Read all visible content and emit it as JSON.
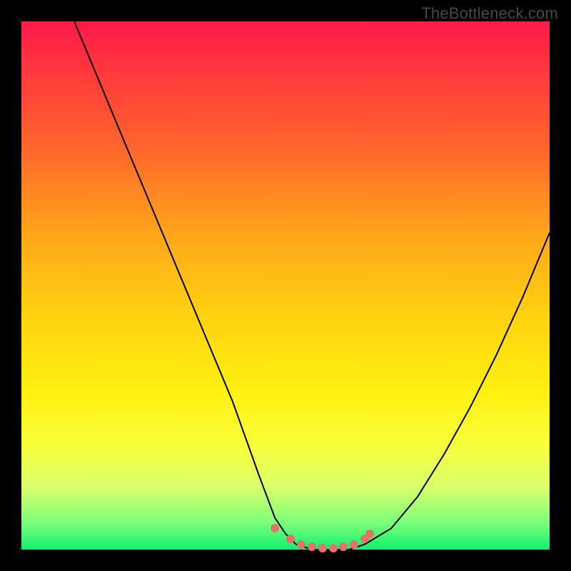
{
  "watermark": "TheBottleneck.com",
  "chart_data": {
    "type": "line",
    "title": "",
    "xlabel": "",
    "ylabel": "",
    "xlim": [
      0,
      100
    ],
    "ylim": [
      0,
      100
    ],
    "series": [
      {
        "name": "curve",
        "x": [
          10,
          15,
          20,
          25,
          30,
          35,
          40,
          45,
          48,
          50,
          52,
          55,
          58,
          60,
          62,
          65,
          70,
          75,
          80,
          85,
          90,
          95,
          100
        ],
        "y": [
          100,
          88,
          76,
          64,
          52,
          40,
          28,
          14,
          6,
          3,
          1,
          0,
          0,
          0,
          0,
          1,
          4,
          10,
          18,
          27,
          37,
          48,
          60
        ]
      }
    ],
    "markers": {
      "name": "bottom-dots",
      "x": [
        48,
        51,
        53,
        55,
        57,
        59,
        61,
        63,
        65,
        66
      ],
      "y": [
        4,
        2,
        1,
        0.5,
        0.3,
        0.3,
        0.5,
        1,
        2,
        3
      ]
    },
    "gradient_stops": [
      {
        "pos": 0,
        "color": "#ff1a4a"
      },
      {
        "pos": 40,
        "color": "#ffa51a"
      },
      {
        "pos": 70,
        "color": "#fff010"
      },
      {
        "pos": 100,
        "color": "#10f070"
      }
    ]
  }
}
